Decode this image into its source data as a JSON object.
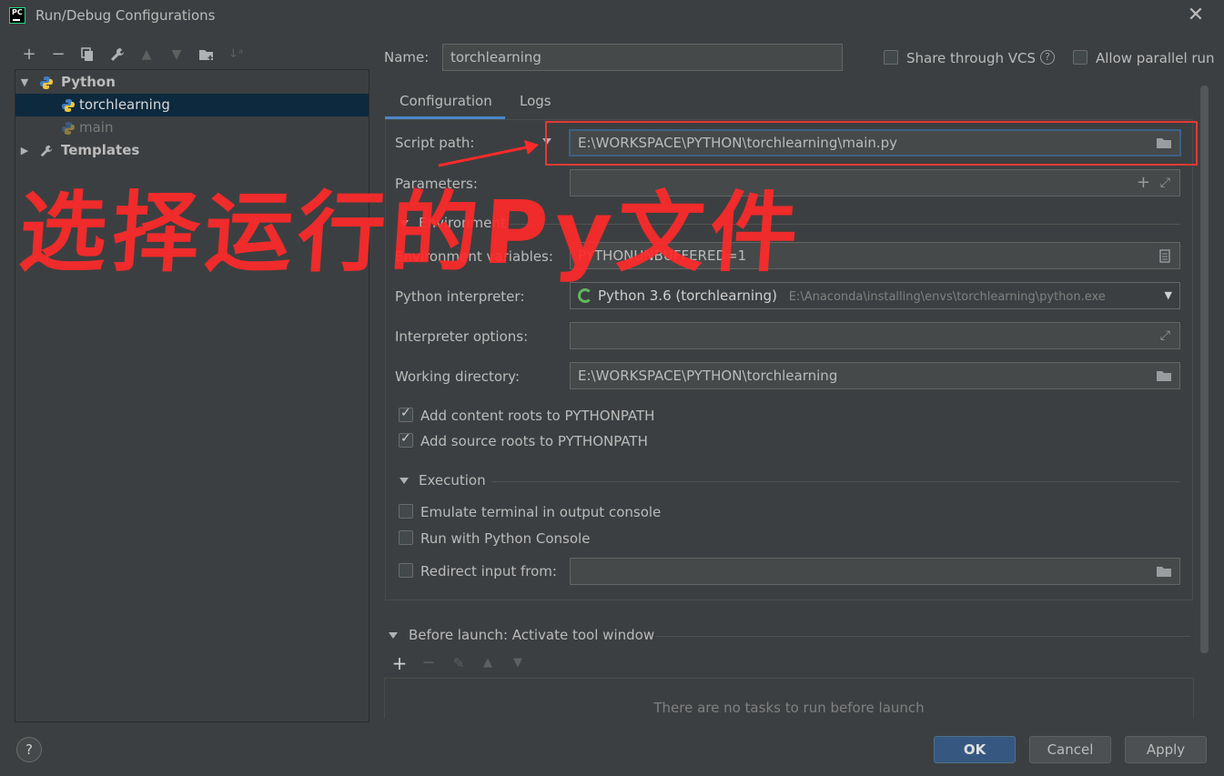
{
  "window": {
    "title": "Run/Debug Configurations",
    "app_icon_text": "PC"
  },
  "tree": {
    "group_python": "Python",
    "item_selected": "torchlearning",
    "item_main": "main",
    "group_templates": "Templates"
  },
  "header": {
    "name_label": "Name:",
    "name_value": "torchlearning",
    "share_vcs_label": "Share through VCS",
    "allow_parallel_label": "Allow parallel run"
  },
  "tabs": [
    {
      "label": "Configuration"
    },
    {
      "label": "Logs"
    }
  ],
  "form": {
    "script_path_label": "Script path:",
    "script_path_value": "E:\\WORKSPACE\\PYTHON\\torchlearning\\main.py",
    "parameters_label": "Parameters:",
    "environment_section": "Environment",
    "env_vars_label": "Environment variables:",
    "env_vars_value": "PYTHONUNBUFFERED=1",
    "interpreter_label": "Python interpreter:",
    "interpreter_name": "Python 3.6 (torchlearning)",
    "interpreter_path": "E:\\Anaconda\\installing\\envs\\torchlearning\\python.exe",
    "interpreter_options_label": "Interpreter options:",
    "working_dir_label": "Working directory:",
    "working_dir_value": "E:\\WORKSPACE\\PYTHON\\torchlearning",
    "add_content_roots": "Add content roots to PYTHONPATH",
    "add_source_roots": "Add source roots to PYTHONPATH",
    "execution_section": "Execution",
    "emulate_terminal": "Emulate terminal in output console",
    "run_with_console": "Run with Python Console",
    "redirect_input": "Redirect input from:"
  },
  "before_launch": {
    "title": "Before launch: Activate tool window",
    "empty_text": "There are no tasks to run before launch"
  },
  "buttons": {
    "ok": "OK",
    "cancel": "Cancel",
    "apply": "Apply"
  },
  "annotation": {
    "text": "选择运行的Py文件",
    "color": "#ff2a2a"
  },
  "colors": {
    "background": "#3c3f41",
    "selection": "#0d293e",
    "accent": "#4a88c7",
    "primary_button": "#365880"
  }
}
